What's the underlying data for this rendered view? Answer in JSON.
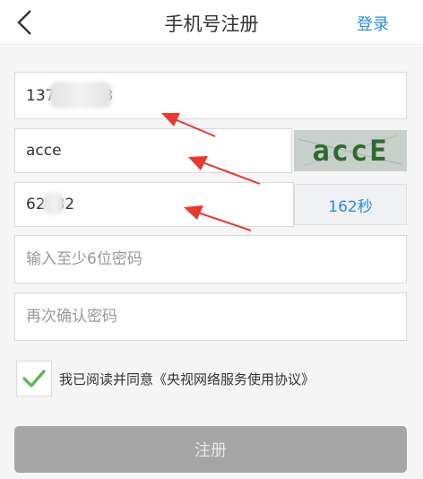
{
  "header": {
    "title": "手机号注册",
    "login_label": "登录",
    "back_icon": "chevron-left-icon"
  },
  "form": {
    "phone_value": "137        33",
    "captcha_input_value": "acce",
    "captcha_image_text": "accE",
    "sms_code_value": "62  82",
    "countdown_label": "162秒",
    "password_placeholder": "输入至少6位密码",
    "confirm_password_placeholder": "再次确认密码"
  },
  "agreement": {
    "checked": true,
    "text": "我已阅读并同意《央视网络服务使用协议》"
  },
  "register_label": "注册",
  "colors": {
    "accent": "#2d8ddb",
    "check": "#5cb85c",
    "arrow": "#e8382f",
    "button_disabled": "#a6a6a6"
  }
}
